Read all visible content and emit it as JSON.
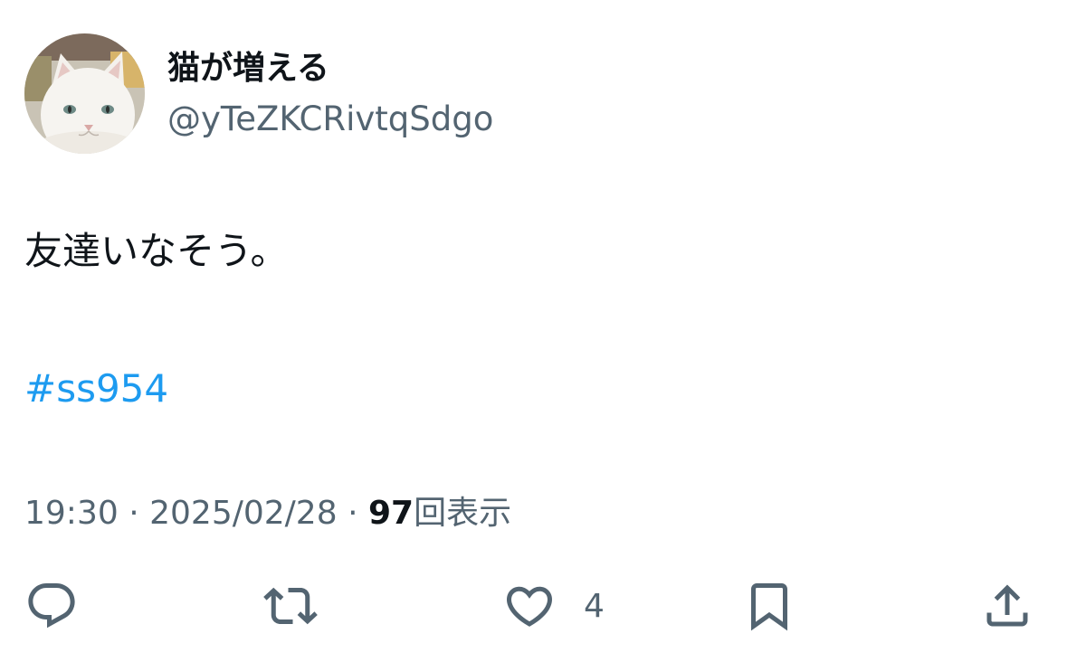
{
  "user": {
    "display_name": "猫が増える",
    "handle": "@yTeZKCRivtqSdgo"
  },
  "tweet": {
    "text": "友達いなそう。",
    "hashtag": "#ss954",
    "time": "19:30",
    "date": "2025/02/28",
    "separator": "·",
    "views_count": "97",
    "views_label": "回表示"
  },
  "actions": {
    "reply_icon": "reply-icon",
    "retweet_icon": "retweet-icon",
    "like_icon": "heart-icon",
    "like_count": "4",
    "bookmark_icon": "bookmark-icon",
    "share_icon": "share-icon"
  },
  "colors": {
    "text_primary": "#0f1419",
    "text_secondary": "#536471",
    "link": "#1d9bf0"
  }
}
